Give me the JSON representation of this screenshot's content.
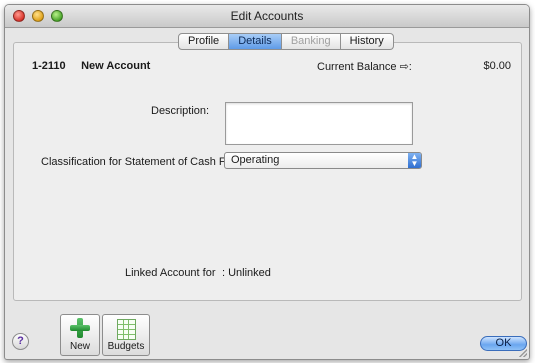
{
  "window": {
    "title": "Edit Accounts"
  },
  "tabs": [
    {
      "label": "Profile",
      "state": "normal"
    },
    {
      "label": "Details",
      "state": "active"
    },
    {
      "label": "Banking",
      "state": "disabled"
    },
    {
      "label": "History",
      "state": "normal"
    }
  ],
  "account": {
    "number": "1-2110",
    "name": "New Account"
  },
  "balance": {
    "label": "Current Balance",
    "arrow_icon": "arrow-right-icon",
    "colon": ":",
    "value": "$0.00"
  },
  "description": {
    "label": "Description:",
    "value": ""
  },
  "classification": {
    "label": "Classification for Statement of Cash Flows:",
    "value": "Operating"
  },
  "linked": {
    "label": "Linked Account for",
    "value": ": Unlinked"
  },
  "toolbar": {
    "new_label": "New",
    "new_icon": "plus-icon",
    "budgets_label": "Budgets",
    "budgets_icon": "spreadsheet-icon",
    "help_icon": "help-icon",
    "help_glyph": "?"
  },
  "ok_label": "OK",
  "colors": {
    "accent": "#5f9be8",
    "window_bg": "#e6e6e6",
    "plus_green": "#1f8a2e"
  }
}
